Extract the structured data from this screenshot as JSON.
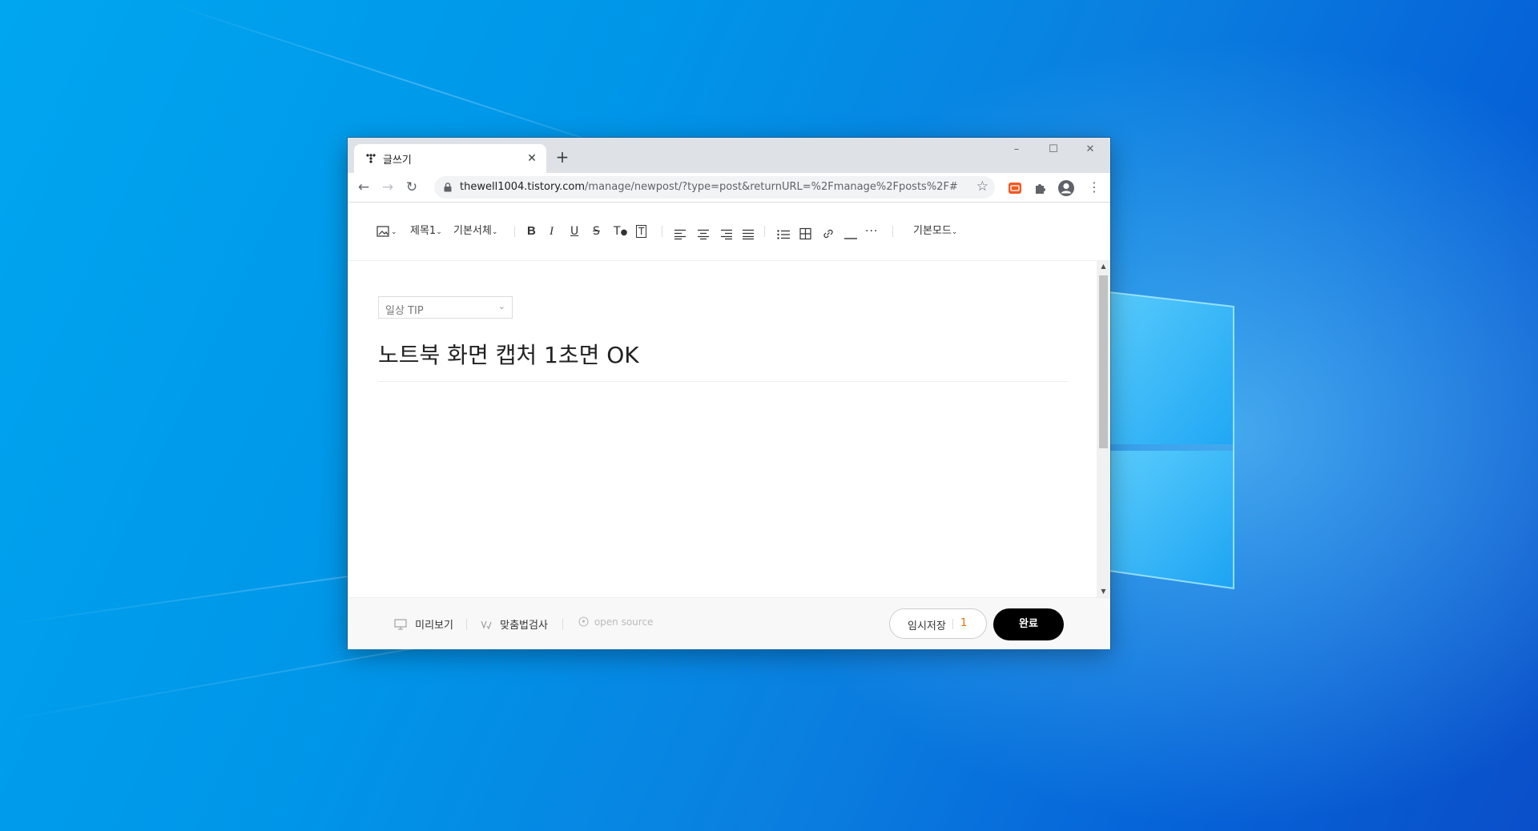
{
  "browser": {
    "tab": {
      "title": "글쓰기",
      "close_icon": "close-icon"
    },
    "new_tab_symbol": "+",
    "window_controls": {
      "minimize": "–",
      "maximize": "☐",
      "close": "✕"
    },
    "url_host": "thewell1004.tistory.com",
    "url_path": "/manage/newpost/?type=post&returnURL=%2Fmanage%2Fposts%2F#"
  },
  "editor": {
    "toolbar": {
      "heading": "제목1",
      "font": "기본서체",
      "mode": "기본모드"
    },
    "category": "일상 TIP",
    "post_title": "노트북 화면 캡처 1초면 OK"
  },
  "footer": {
    "preview": "미리보기",
    "spellcheck": "맞춤법검사",
    "open_source": "open source",
    "draft_label": "임시저장",
    "draft_count": "1",
    "publish": "완료"
  },
  "colors": {
    "wallpaper_accent": "#0095e8",
    "draft_count": "#f56a00",
    "publish_button": "#000000"
  }
}
